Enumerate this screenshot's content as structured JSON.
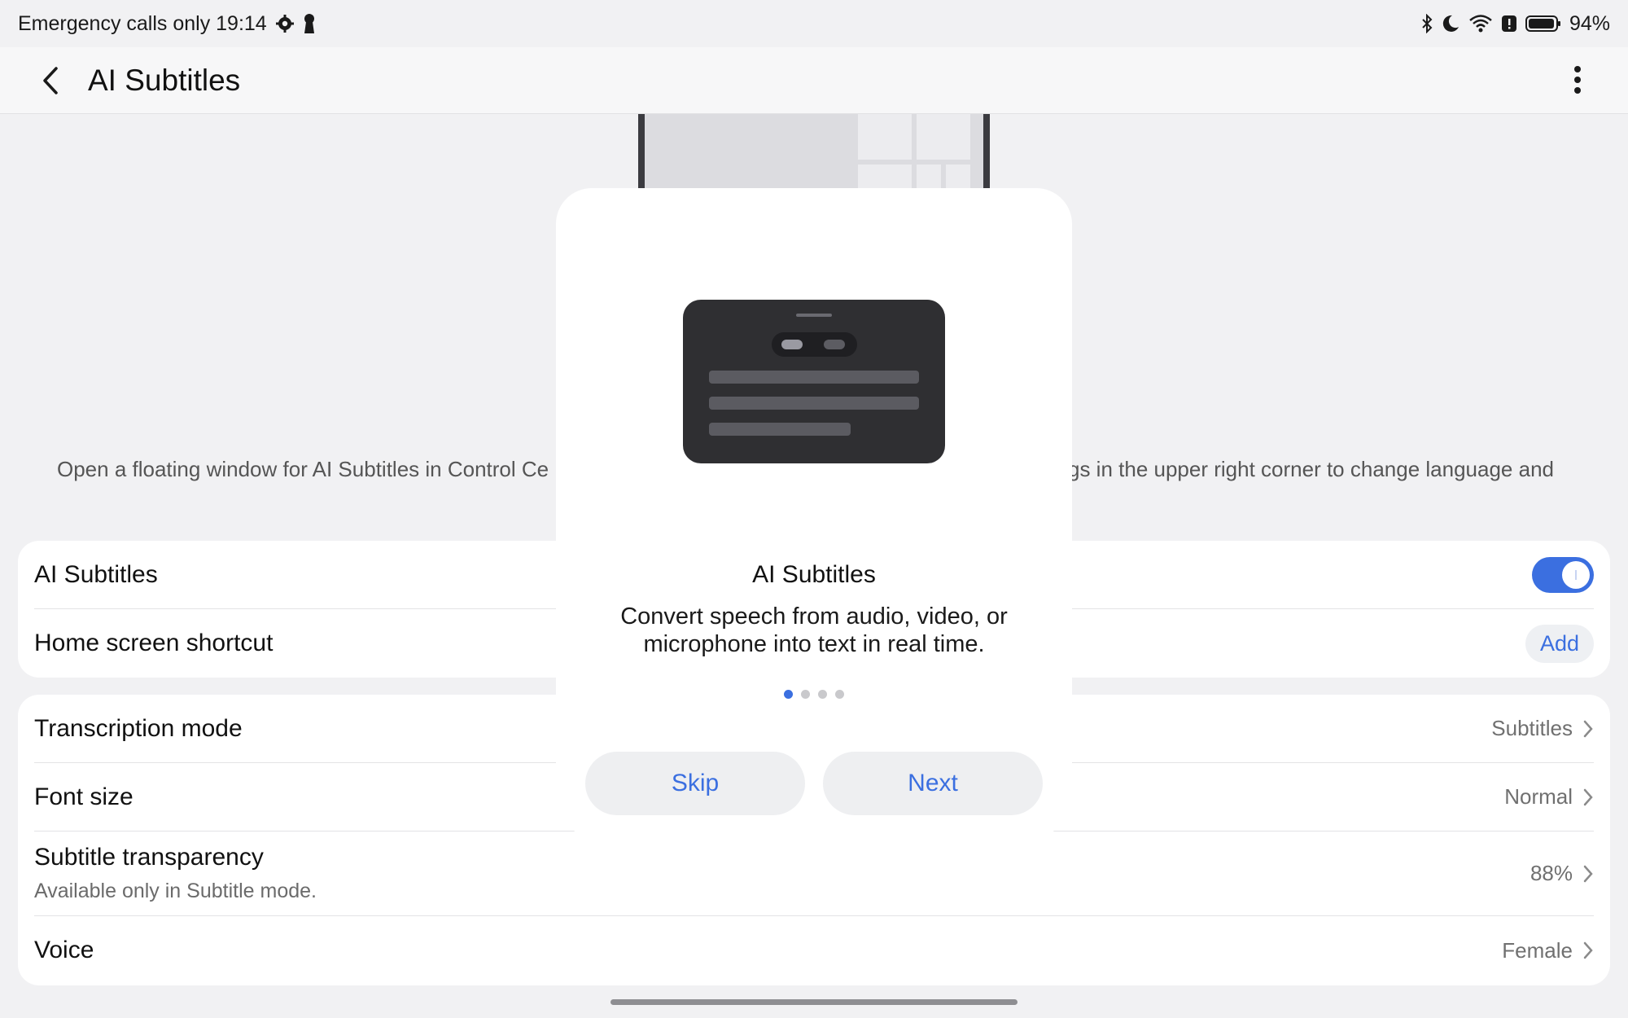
{
  "status_bar": {
    "left_text": "Emergency calls only 19:14",
    "battery": "94%"
  },
  "header": {
    "title": "AI Subtitles"
  },
  "intro": {
    "visible_left": "Open a floating window for AI Subtitles in Control Ce",
    "visible_right": "gs in the upper right corner to change language and"
  },
  "card1": {
    "rows": [
      {
        "title": "AI Subtitles",
        "toggle_on": true
      },
      {
        "title": "Home screen shortcut",
        "action": "Add"
      }
    ]
  },
  "card2": {
    "rows": [
      {
        "title": "Transcription mode",
        "value": "Subtitles"
      },
      {
        "title": "Font size",
        "value": "Normal"
      },
      {
        "title": "Subtitle transparency",
        "subtitle": "Available only in Subtitle mode.",
        "value": "88%"
      },
      {
        "title": "Voice",
        "value": "Female"
      }
    ]
  },
  "modal": {
    "title": "AI Subtitles",
    "description": "Convert speech from audio, video, or microphone into text in real time.",
    "page_index": 1,
    "page_count": 4,
    "skip_label": "Skip",
    "next_label": "Next"
  },
  "colors": {
    "accent": "#3b6fe0",
    "background": "#f1f1f3",
    "card": "#ffffff"
  }
}
